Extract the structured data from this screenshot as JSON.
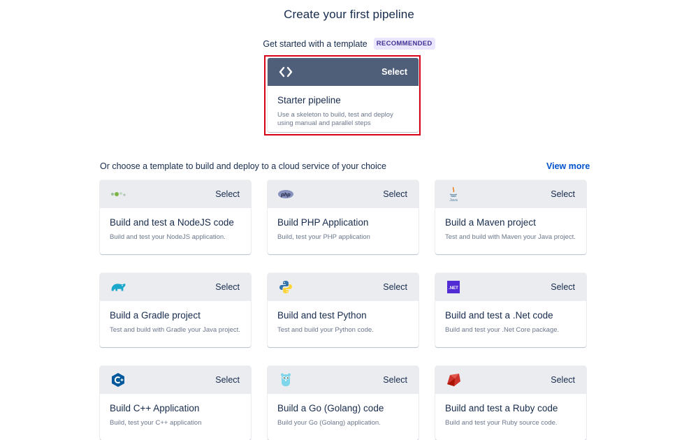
{
  "page": {
    "title": "Create your first pipeline"
  },
  "recommended": {
    "label": "Get started with a template",
    "badge": "RECOMMENDED",
    "card": {
      "icon": "code-brackets-icon",
      "select_label": "Select",
      "title": "Starter pipeline",
      "description": "Use a skeleton to build, test and deploy using manual and parallel steps"
    }
  },
  "templates": {
    "section_title": "Or choose a template to build and deploy to a cloud service of your choice",
    "view_more": "View more",
    "cards": [
      {
        "icon": "nodejs-icon",
        "select_label": "Select",
        "title": "Build and test a NodeJS code",
        "description": "Build and test your NodeJS application."
      },
      {
        "icon": "php-icon",
        "select_label": "Select",
        "title": "Build PHP Application",
        "description": "Build, test your PHP application"
      },
      {
        "icon": "java-icon",
        "select_label": "Select",
        "title": "Build a Maven project",
        "description": "Test and build with Maven your Java project."
      },
      {
        "icon": "gradle-icon",
        "select_label": "Select",
        "title": "Build a Gradle project",
        "description": "Test and build with Gradle your Java project."
      },
      {
        "icon": "python-icon",
        "select_label": "Select",
        "title": "Build and test Python",
        "description": "Test and build your Python code."
      },
      {
        "icon": "dotnet-icon",
        "select_label": "Select",
        "title": "Build and test a .Net code",
        "description": "Build and test your .Net Core package."
      },
      {
        "icon": "cplusplus-icon",
        "select_label": "Select",
        "title": "Build C++ Application",
        "description": "Build, test your C++ application"
      },
      {
        "icon": "golang-icon",
        "select_label": "Select",
        "title": "Build a Go (Golang) code",
        "description": "Build your Go (Golang) application."
      },
      {
        "icon": "ruby-icon",
        "select_label": "Select",
        "title": "Build and test a Ruby code",
        "description": "Build and test your Ruby source code."
      }
    ],
    "icon_text": {
      "php": "php",
      "java": "Java",
      "dotnet": ".NET"
    }
  },
  "colors": {
    "highlight": "#d70015",
    "starter_header": "#505f79",
    "card_header": "#ebecf0",
    "link": "#0052cc",
    "badge_bg": "#eae6ff",
    "badge_text": "#403294"
  }
}
